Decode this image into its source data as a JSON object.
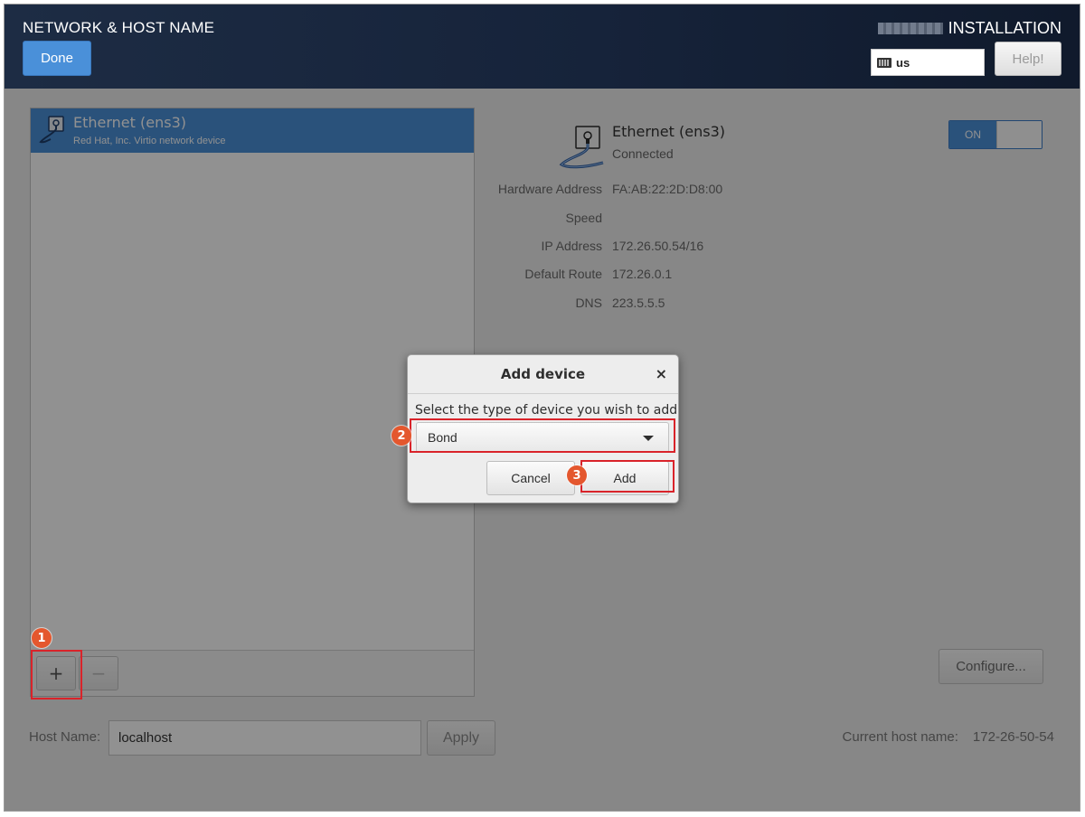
{
  "header": {
    "page_title": "NETWORK & HOST NAME",
    "done_label": "Done",
    "product_suffix": "INSTALLATION",
    "keyboard_layout": "us",
    "help_label": "Help!"
  },
  "device_list": {
    "items": [
      {
        "name": "Ethernet (ens3)",
        "description": "Red Hat, Inc. Virtio network device",
        "selected": true
      }
    ],
    "add_label": "+",
    "remove_label": "−"
  },
  "details": {
    "name": "Ethernet (ens3)",
    "status": "Connected",
    "toggle_label": "ON",
    "properties": [
      {
        "label": "Hardware Address",
        "value": "FA:AB:22:2D:D8:00"
      },
      {
        "label": "Speed",
        "value": ""
      },
      {
        "label": "IP Address",
        "value": "172.26.50.54/16"
      },
      {
        "label": "Default Route",
        "value": "172.26.0.1"
      },
      {
        "label": "DNS",
        "value": "223.5.5.5"
      }
    ],
    "configure_label": "Configure..."
  },
  "host": {
    "label": "Host Name:",
    "value": "localhost",
    "apply_label": "Apply",
    "current_label": "Current host name:",
    "current_value": "172-26-50-54"
  },
  "dialog": {
    "title": "Add device",
    "close_label": "×",
    "prompt": "Select the type of device you wish to add",
    "selected_type": "Bond",
    "cancel_label": "Cancel",
    "add_label": "Add"
  },
  "annotations": {
    "steps": [
      "1",
      "2",
      "3"
    ],
    "highlight_color": "#d9232a",
    "badge_color": "#e4572e"
  },
  "colors": {
    "header_bg": "#16233a",
    "accent": "#4a90d9"
  }
}
